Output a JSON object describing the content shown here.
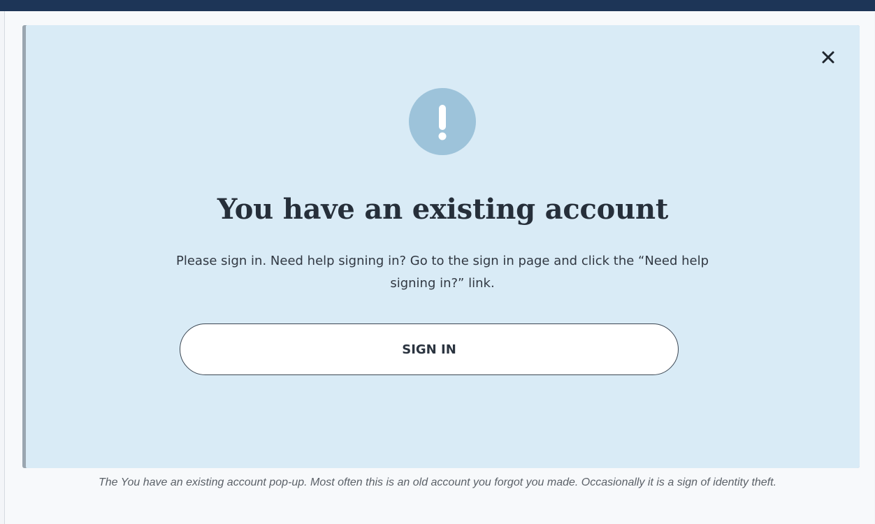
{
  "modal": {
    "title": "You have an existing account",
    "message": "Please sign in. Need help signing in? Go to the sign in page and click the “Need help signing in?” link.",
    "signin_label": "SIGN IN",
    "close_icon": "close-icon",
    "alert_icon": "exclamation-icon"
  },
  "caption": "The You have an existing account pop-up. Most often this is an old account you forgot you made. Occasionally it is a sign of identity theft.",
  "colors": {
    "header_bar": "#1d3557",
    "modal_bg": "#d9ebf6",
    "alert_circle": "#9dc3da",
    "title_text": "#262f3a"
  }
}
